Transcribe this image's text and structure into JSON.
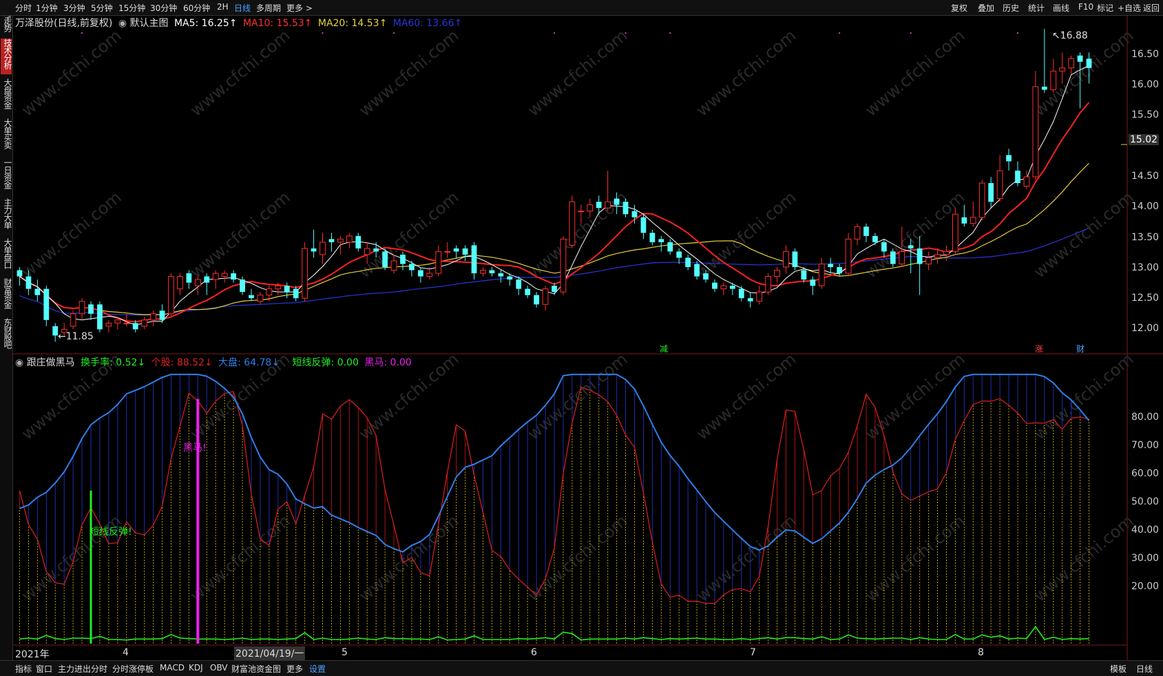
{
  "topbar": {
    "periods": [
      "分时",
      "1分钟",
      "3分钟",
      "5分钟",
      "15分钟",
      "30分钟",
      "60分钟",
      "2H",
      "日线",
      "多周期",
      "更多 >"
    ],
    "active_period": "日线",
    "right_buttons": [
      "复权",
      "叠加",
      "历史",
      "统计",
      "画线",
      "F10",
      "标记",
      "+自选",
      "返回"
    ]
  },
  "sidebar": {
    "items": [
      "分时走势",
      "技术分析",
      "大盘资金",
      "大单买卖",
      "一日资金",
      "主力大单",
      "大单盘口",
      "财富资金",
      "东财股吧"
    ],
    "active": "技术分析"
  },
  "main_header": {
    "stock": "万泽股份(日线,前复权)",
    "template": "默认主图",
    "ma5": "MA5: 16.25↑",
    "ma10": "MA10: 15.53↑",
    "ma20": "MA20: 14.53↑",
    "ma60": "MA60: 13.66↑"
  },
  "indicator_header": {
    "name": "跟庄做黑马",
    "turnover": "换手率: 0.52↓",
    "stock": "个股: 88.52↓",
    "market": "大盘: 64.78↓",
    "rebound": "短线反弹: 0.00",
    "dark_horse": "黑马: 0.00"
  },
  "price_axis": {
    "ticks": [
      "16.50",
      "16.00",
      "15.50",
      "15.02",
      "14.50",
      "14.00",
      "13.50",
      "13.00",
      "12.50",
      "12.00"
    ],
    "current": "15.02"
  },
  "indicator_axis": {
    "ticks": [
      "80.00",
      "70.00",
      "60.00",
      "50.00",
      "40.00",
      "30.00",
      "20.00"
    ]
  },
  "annotations": {
    "high": "16.88",
    "low": "11.85",
    "event_jian": "减",
    "event_zhang": "涨",
    "event_cai": "财",
    "rebound_label": "短线反弹!",
    "dark_horse_label": "黑马!"
  },
  "time_axis": {
    "labels": [
      "2021年",
      "4",
      "2021/04/19/一",
      "5",
      "6",
      "7",
      "8"
    ]
  },
  "bottombar": {
    "tabs": [
      "指标",
      "窗口",
      "主力进出分时",
      "分时涨停板",
      "MACD",
      "KDJ",
      "OBV",
      "财富池资金图",
      "更多",
      "设置"
    ],
    "active": "设置",
    "right": [
      "模板",
      "日线"
    ]
  },
  "watermark": "www.cfchi.com",
  "colors": {
    "up": "#ff3030",
    "down": "#54ffff",
    "ma5": "#ffffff",
    "ma10": "#ff2020",
    "ma20": "#e6d33b",
    "ma60": "#2a35d8",
    "stock_line": "#e02020",
    "market_line": "#2f7fe8",
    "rebound": "#22ee22",
    "dark_horse": "#ee22ee"
  },
  "chart_data": {
    "type": "candlestick",
    "price_range": [
      11.7,
      16.9
    ],
    "indicator_range": [
      0,
      90
    ],
    "candles": [
      [
        13.0,
        12.9,
        13.05,
        12.75
      ],
      [
        12.9,
        12.7,
        13.0,
        12.6
      ],
      [
        12.7,
        12.6,
        12.85,
        12.5
      ],
      [
        12.7,
        12.2,
        12.75,
        12.1
      ],
      [
        12.1,
        11.95,
        12.15,
        11.85
      ],
      [
        12.0,
        12.05,
        12.15,
        11.95
      ],
      [
        12.1,
        12.3,
        12.35,
        12.05
      ],
      [
        12.3,
        12.5,
        12.55,
        12.2
      ],
      [
        12.45,
        12.3,
        12.5,
        12.2
      ],
      [
        12.45,
        12.05,
        12.5,
        12.0
      ],
      [
        12.1,
        12.15,
        12.2,
        12.0
      ],
      [
        12.15,
        12.2,
        12.25,
        12.05
      ],
      [
        12.15,
        12.15,
        12.3,
        12.1
      ],
      [
        12.15,
        12.05,
        12.2,
        12.0
      ],
      [
        12.1,
        12.2,
        12.25,
        12.05
      ],
      [
        12.2,
        12.3,
        12.35,
        12.1
      ],
      [
        12.35,
        12.2,
        12.45,
        12.15
      ],
      [
        12.3,
        12.9,
        12.95,
        12.25
      ],
      [
        12.7,
        12.9,
        12.95,
        12.6
      ],
      [
        12.95,
        12.8,
        13.0,
        12.7
      ],
      [
        12.75,
        12.85,
        12.9,
        12.6
      ],
      [
        12.9,
        12.8,
        12.95,
        12.6
      ],
      [
        12.85,
        12.95,
        13.0,
        12.7
      ],
      [
        12.9,
        12.95,
        13.0,
        12.8
      ],
      [
        12.95,
        12.85,
        13.0,
        12.8
      ],
      [
        12.85,
        12.65,
        12.9,
        12.6
      ],
      [
        12.6,
        12.55,
        12.7,
        12.5
      ],
      [
        12.5,
        12.6,
        12.65,
        12.45
      ],
      [
        12.6,
        12.7,
        12.75,
        12.5
      ],
      [
        12.7,
        12.75,
        12.8,
        12.6
      ],
      [
        12.75,
        12.65,
        12.8,
        12.55
      ],
      [
        12.7,
        12.55,
        12.75,
        12.5
      ],
      [
        12.55,
        13.35,
        13.45,
        12.5
      ],
      [
        13.35,
        13.3,
        13.65,
        13.2
      ],
      [
        13.25,
        13.45,
        13.6,
        13.1
      ],
      [
        13.5,
        13.45,
        13.6,
        13.3
      ],
      [
        13.45,
        13.5,
        13.55,
        13.25
      ],
      [
        13.45,
        13.55,
        13.6,
        13.35
      ],
      [
        13.55,
        13.35,
        13.6,
        13.3
      ],
      [
        13.25,
        13.35,
        13.45,
        13.1
      ],
      [
        13.35,
        13.3,
        13.45,
        13.2
      ],
      [
        13.3,
        13.05,
        13.35,
        13.0
      ],
      [
        13.0,
        13.15,
        13.25,
        12.95
      ],
      [
        13.25,
        13.1,
        13.3,
        13.0
      ],
      [
        13.1,
        13.0,
        13.15,
        12.9
      ],
      [
        13.0,
        12.9,
        13.05,
        12.8
      ],
      [
        12.9,
        12.95,
        13.05,
        12.85
      ],
      [
        12.95,
        13.3,
        13.4,
        12.9
      ],
      [
        13.3,
        13.3,
        13.45,
        13.2
      ],
      [
        13.35,
        13.3,
        13.4,
        13.2
      ],
      [
        13.35,
        13.25,
        13.4,
        13.15
      ],
      [
        13.4,
        12.95,
        13.45,
        12.85
      ],
      [
        12.95,
        13.0,
        13.05,
        12.9
      ],
      [
        13.0,
        12.95,
        13.05,
        12.9
      ],
      [
        12.95,
        12.9,
        13.0,
        12.8
      ],
      [
        12.9,
        12.85,
        12.95,
        12.75
      ],
      [
        12.85,
        12.7,
        12.9,
        12.6
      ],
      [
        12.7,
        12.6,
        12.75,
        12.55
      ],
      [
        12.6,
        12.45,
        12.65,
        12.4
      ],
      [
        12.45,
        12.7,
        12.75,
        12.35
      ],
      [
        12.75,
        12.65,
        12.8,
        12.6
      ],
      [
        12.65,
        13.5,
        13.55,
        12.6
      ],
      [
        13.4,
        14.1,
        14.2,
        13.35
      ],
      [
        13.95,
        13.95,
        14.05,
        13.75
      ],
      [
        13.95,
        14.05,
        14.15,
        13.85
      ],
      [
        14.1,
        14.0,
        14.2,
        13.9
      ],
      [
        14.0,
        14.1,
        14.6,
        13.95
      ],
      [
        14.15,
        14.05,
        14.25,
        13.9
      ],
      [
        14.1,
        13.9,
        14.15,
        13.85
      ],
      [
        13.95,
        13.85,
        14.05,
        13.75
      ],
      [
        13.85,
        13.6,
        13.9,
        13.5
      ],
      [
        13.6,
        13.45,
        13.65,
        13.4
      ],
      [
        13.5,
        13.45,
        13.55,
        13.3
      ],
      [
        13.45,
        13.3,
        13.5,
        13.25
      ],
      [
        13.3,
        13.2,
        13.35,
        13.1
      ],
      [
        13.2,
        13.05,
        13.25,
        13.0
      ],
      [
        13.1,
        12.9,
        13.15,
        12.85
      ],
      [
        12.95,
        12.85,
        13.0,
        12.8
      ],
      [
        12.8,
        12.7,
        12.85,
        12.65
      ],
      [
        12.7,
        12.75,
        12.8,
        12.6
      ],
      [
        12.75,
        12.7,
        12.8,
        12.6
      ],
      [
        12.7,
        12.55,
        12.75,
        12.5
      ],
      [
        12.55,
        12.5,
        12.65,
        12.4
      ],
      [
        12.5,
        12.65,
        12.75,
        12.45
      ],
      [
        12.65,
        12.9,
        12.95,
        12.6
      ],
      [
        12.9,
        13.0,
        13.05,
        12.8
      ],
      [
        13.05,
        13.3,
        13.4,
        12.95
      ],
      [
        13.3,
        13.05,
        13.35,
        13.0
      ],
      [
        13.0,
        12.85,
        13.05,
        12.8
      ],
      [
        12.85,
        12.75,
        12.9,
        12.6
      ],
      [
        12.75,
        13.1,
        13.2,
        12.7
      ],
      [
        13.1,
        13.05,
        13.2,
        12.95
      ],
      [
        13.05,
        12.95,
        13.1,
        12.9
      ],
      [
        12.95,
        13.5,
        13.6,
        12.9
      ],
      [
        13.5,
        13.7,
        13.75,
        13.4
      ],
      [
        13.7,
        13.55,
        13.75,
        13.45
      ],
      [
        13.55,
        13.45,
        13.6,
        13.4
      ],
      [
        13.45,
        13.3,
        13.5,
        13.2
      ],
      [
        13.3,
        13.1,
        13.35,
        13.05
      ],
      [
        13.1,
        13.3,
        13.7,
        13.05
      ],
      [
        13.4,
        13.35,
        13.5,
        12.95
      ],
      [
        13.35,
        13.1,
        13.55,
        12.6
      ],
      [
        13.1,
        13.2,
        13.3,
        13.0
      ],
      [
        13.2,
        13.25,
        13.35,
        13.1
      ],
      [
        13.25,
        13.3,
        13.4,
        13.15
      ],
      [
        13.3,
        13.9,
        14.0,
        13.25
      ],
      [
        13.85,
        13.75,
        14.05,
        13.7
      ],
      [
        13.75,
        13.85,
        14.1,
        13.7
      ],
      [
        13.85,
        14.4,
        14.45,
        13.8
      ],
      [
        14.4,
        14.1,
        14.5,
        14.0
      ],
      [
        14.15,
        14.6,
        14.85,
        14.1
      ],
      [
        14.85,
        14.75,
        14.95,
        14.6
      ],
      [
        14.6,
        14.4,
        14.75,
        14.35
      ],
      [
        14.35,
        14.5,
        14.6,
        14.3
      ],
      [
        14.5,
        15.95,
        16.2,
        14.45
      ],
      [
        15.95,
        15.9,
        16.88,
        15.85
      ],
      [
        15.9,
        16.2,
        16.4,
        15.85
      ],
      [
        16.2,
        16.25,
        16.5,
        16.0
      ],
      [
        16.25,
        16.4,
        16.45,
        16.15
      ],
      [
        16.45,
        16.35,
        16.5,
        15.6
      ],
      [
        16.4,
        16.25,
        16.5,
        16.0
      ]
    ]
  }
}
